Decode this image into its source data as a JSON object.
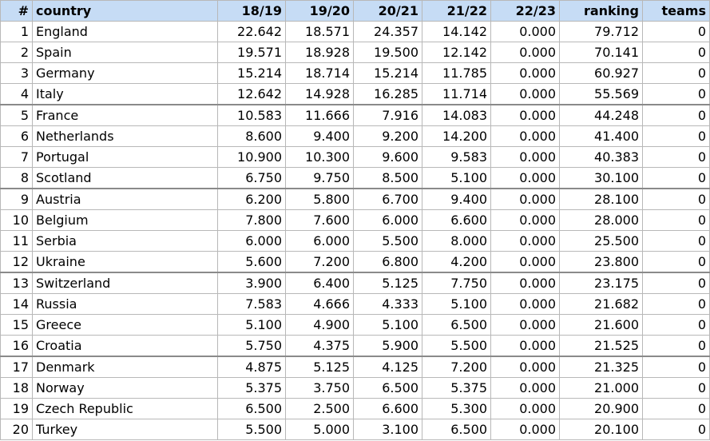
{
  "table": {
    "headers": [
      "#",
      "country",
      "18/19",
      "19/20",
      "20/21",
      "21/22",
      "22/23",
      "ranking",
      "teams"
    ],
    "rows": [
      [
        "1",
        "England",
        "22.642",
        "18.571",
        "24.357",
        "14.142",
        "0.000",
        "79.712",
        "0"
      ],
      [
        "2",
        "Spain",
        "19.571",
        "18.928",
        "19.500",
        "12.142",
        "0.000",
        "70.141",
        "0"
      ],
      [
        "3",
        "Germany",
        "15.214",
        "18.714",
        "15.214",
        "11.785",
        "0.000",
        "60.927",
        "0"
      ],
      [
        "4",
        "Italy",
        "12.642",
        "14.928",
        "16.285",
        "11.714",
        "0.000",
        "55.569",
        "0"
      ],
      [
        "5",
        "France",
        "10.583",
        "11.666",
        "7.916",
        "14.083",
        "0.000",
        "44.248",
        "0"
      ],
      [
        "6",
        "Netherlands",
        "8.600",
        "9.400",
        "9.200",
        "14.200",
        "0.000",
        "41.400",
        "0"
      ],
      [
        "7",
        "Portugal",
        "10.900",
        "10.300",
        "9.600",
        "9.583",
        "0.000",
        "40.383",
        "0"
      ],
      [
        "8",
        "Scotland",
        "6.750",
        "9.750",
        "8.500",
        "5.100",
        "0.000",
        "30.100",
        "0"
      ],
      [
        "9",
        "Austria",
        "6.200",
        "5.800",
        "6.700",
        "9.400",
        "0.000",
        "28.100",
        "0"
      ],
      [
        "10",
        "Belgium",
        "7.800",
        "7.600",
        "6.000",
        "6.600",
        "0.000",
        "28.000",
        "0"
      ],
      [
        "11",
        "Serbia",
        "6.000",
        "6.000",
        "5.500",
        "8.000",
        "0.000",
        "25.500",
        "0"
      ],
      [
        "12",
        "Ukraine",
        "5.600",
        "7.200",
        "6.800",
        "4.200",
        "0.000",
        "23.800",
        "0"
      ],
      [
        "13",
        "Switzerland",
        "3.900",
        "6.400",
        "5.125",
        "7.750",
        "0.000",
        "23.175",
        "0"
      ],
      [
        "14",
        "Russia",
        "7.583",
        "4.666",
        "4.333",
        "5.100",
        "0.000",
        "21.682",
        "0"
      ],
      [
        "15",
        "Greece",
        "5.100",
        "4.900",
        "5.100",
        "6.500",
        "0.000",
        "21.600",
        "0"
      ],
      [
        "16",
        "Croatia",
        "5.750",
        "4.375",
        "5.900",
        "5.500",
        "0.000",
        "21.525",
        "0"
      ],
      [
        "17",
        "Denmark",
        "4.875",
        "5.125",
        "4.125",
        "7.200",
        "0.000",
        "21.325",
        "0"
      ],
      [
        "18",
        "Norway",
        "5.375",
        "3.750",
        "6.500",
        "5.375",
        "0.000",
        "21.000",
        "0"
      ],
      [
        "19",
        "Czech Republic",
        "6.500",
        "2.500",
        "6.600",
        "5.300",
        "0.000",
        "20.900",
        "0"
      ],
      [
        "20",
        "Turkey",
        "5.500",
        "5.000",
        "3.100",
        "6.500",
        "0.000",
        "20.100",
        "0"
      ]
    ]
  },
  "colors": {
    "header_background": "#c6dcf5",
    "grid_line": "#b8b8b8",
    "group_separator": "#8a8a8a"
  }
}
